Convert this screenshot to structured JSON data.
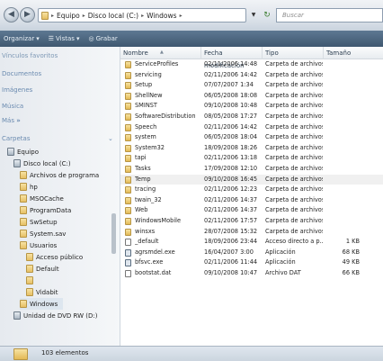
{
  "address": {
    "crumbs": [
      "Equipo",
      "Disco local (C:)",
      "Windows"
    ],
    "search_placeholder": "Buscar"
  },
  "toolbar": {
    "organize": "Organizar",
    "views": "Vistas",
    "burn": "Grabar"
  },
  "nav": {
    "favorites_title": "Vínculos favoritos",
    "favorites": [
      "Documentos",
      "Imágenes",
      "Música",
      "Más"
    ],
    "folders_title": "Carpetas",
    "tree": [
      {
        "label": "Equipo",
        "depth": 0
      },
      {
        "label": "Disco local (C:)",
        "depth": 1
      },
      {
        "label": "Archivos de programa",
        "depth": 2
      },
      {
        "label": "hp",
        "depth": 2
      },
      {
        "label": "MSOCache",
        "depth": 2
      },
      {
        "label": "ProgramData",
        "depth": 2
      },
      {
        "label": "SwSetup",
        "depth": 2
      },
      {
        "label": "System.sav",
        "depth": 2
      },
      {
        "label": "Usuarios",
        "depth": 2
      },
      {
        "label": "Acceso público",
        "depth": 3
      },
      {
        "label": "Default",
        "depth": 3
      },
      {
        "label": "",
        "depth": 3
      },
      {
        "label": "Vidabit",
        "depth": 3
      },
      {
        "label": "Windows",
        "depth": 2
      },
      {
        "label": "Unidad de DVD RW (D:)",
        "depth": 1
      }
    ]
  },
  "columns": {
    "name": "Nombre",
    "modified": "Fecha modificación",
    "type": "Tipo",
    "size": "Tamaño"
  },
  "files": [
    {
      "name": "ServiceProfiles",
      "date": "02/11/2006 14:48",
      "type": "Carpeta de archivos",
      "size": "",
      "icon": "folder"
    },
    {
      "name": "servicing",
      "date": "02/11/2006 14:42",
      "type": "Carpeta de archivos",
      "size": "",
      "icon": "folder"
    },
    {
      "name": "Setup",
      "date": "07/07/2007 1:34",
      "type": "Carpeta de archivos",
      "size": "",
      "icon": "folder"
    },
    {
      "name": "ShellNew",
      "date": "06/05/2008 18:08",
      "type": "Carpeta de archivos",
      "size": "",
      "icon": "folder"
    },
    {
      "name": "SMINST",
      "date": "09/10/2008 10:48",
      "type": "Carpeta de archivos",
      "size": "",
      "icon": "folder"
    },
    {
      "name": "SoftwareDistribution",
      "date": "08/05/2008 17:27",
      "type": "Carpeta de archivos",
      "size": "",
      "icon": "folder"
    },
    {
      "name": "Speech",
      "date": "02/11/2006 14:42",
      "type": "Carpeta de archivos",
      "size": "",
      "icon": "folder"
    },
    {
      "name": "system",
      "date": "06/05/2008 18:04",
      "type": "Carpeta de archivos",
      "size": "",
      "icon": "folder"
    },
    {
      "name": "System32",
      "date": "18/09/2008 18:26",
      "type": "Carpeta de archivos",
      "size": "",
      "icon": "folder"
    },
    {
      "name": "tapi",
      "date": "02/11/2006 13:18",
      "type": "Carpeta de archivos",
      "size": "",
      "icon": "folder"
    },
    {
      "name": "Tasks",
      "date": "17/09/2008 12:10",
      "type": "Carpeta de archivos",
      "size": "",
      "icon": "folder"
    },
    {
      "name": "Temp",
      "date": "09/10/2008 16:45",
      "type": "Carpeta de archivos",
      "size": "",
      "icon": "folder",
      "selected": true
    },
    {
      "name": "tracing",
      "date": "02/11/2006 12:23",
      "type": "Carpeta de archivos",
      "size": "",
      "icon": "folder"
    },
    {
      "name": "twain_32",
      "date": "02/11/2006 14:37",
      "type": "Carpeta de archivos",
      "size": "",
      "icon": "folder"
    },
    {
      "name": "Web",
      "date": "02/11/2006 14:37",
      "type": "Carpeta de archivos",
      "size": "",
      "icon": "folder"
    },
    {
      "name": "WindowsMobile",
      "date": "02/11/2006 17:57",
      "type": "Carpeta de archivos",
      "size": "",
      "icon": "folder"
    },
    {
      "name": "winsxs",
      "date": "28/07/2008 15:32",
      "type": "Carpeta de archivos",
      "size": "",
      "icon": "folder"
    },
    {
      "name": "_default",
      "date": "18/09/2006 23:44",
      "type": "Acceso directo a p...",
      "size": "1 KB",
      "icon": "lnk"
    },
    {
      "name": "agrsmdel.exe",
      "date": "16/04/2007 3:00",
      "type": "Aplicación",
      "size": "68 KB",
      "icon": "exe"
    },
    {
      "name": "bfsvc.exe",
      "date": "02/11/2006 11:44",
      "type": "Aplicación",
      "size": "49 KB",
      "icon": "exe"
    },
    {
      "name": "bootstat.dat",
      "date": "09/10/2008 10:47",
      "type": "Archivo DAT",
      "size": "66 KB",
      "icon": "file"
    }
  ],
  "status": {
    "count": "103 elementos"
  }
}
